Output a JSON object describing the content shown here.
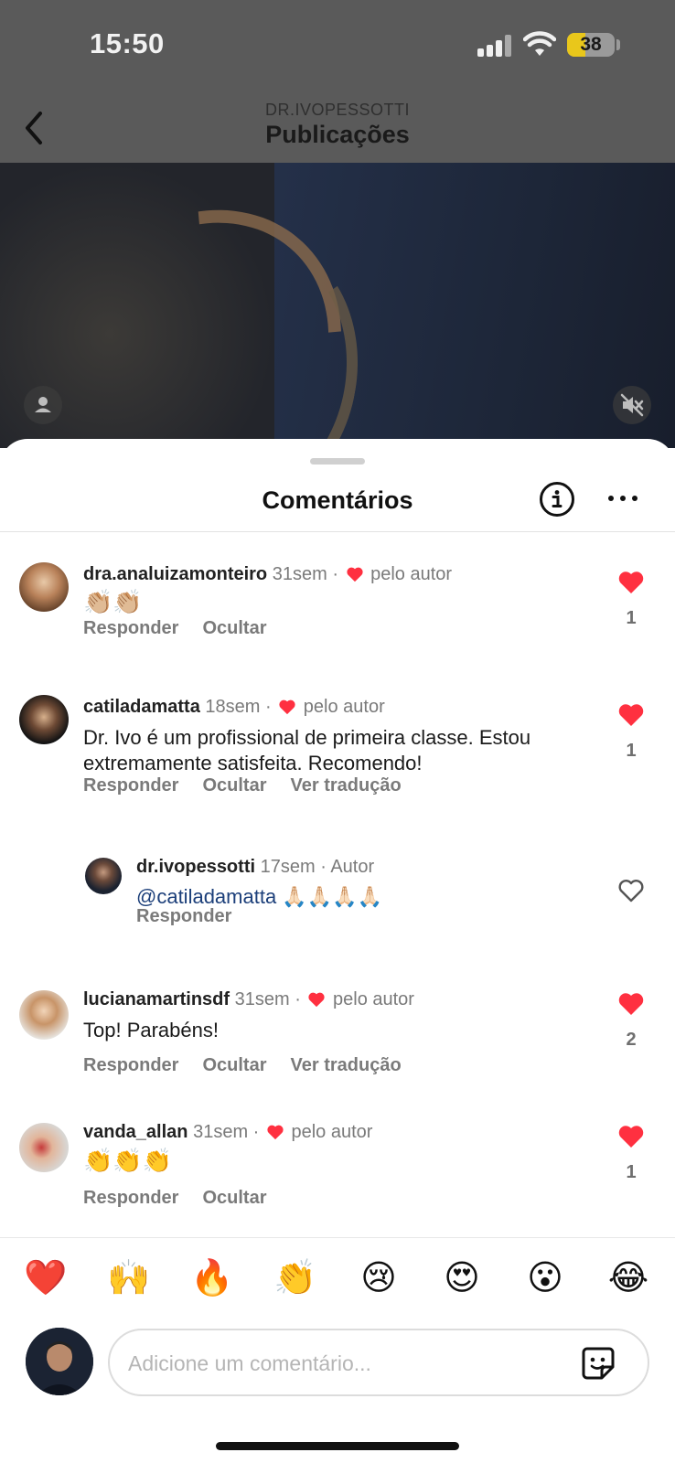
{
  "status_bar": {
    "time": "15:50",
    "battery": "38",
    "battery_level": 0.38
  },
  "header": {
    "subtitle": "DR.IVOPESSOTTI",
    "title": "Publicações"
  },
  "sheet": {
    "title": "Comentários"
  },
  "comments": [
    {
      "user": "dra.analuizamonteiro",
      "time": "31sem",
      "liked_by_author": "pelo autor",
      "text": "👏🏼👏🏼",
      "actions": [
        "Responder",
        "Ocultar"
      ],
      "likes": "1",
      "liked": true
    },
    {
      "user": "catiladamatta",
      "time": "18sem",
      "liked_by_author": "pelo autor",
      "text": "Dr. Ivo é um profissional de primeira classe. Estou extremamente satisfeita. Recomendo!",
      "actions": [
        "Responder",
        "Ocultar",
        "Ver tradução"
      ],
      "likes": "1",
      "liked": true
    },
    {
      "user": "dr.ivopessotti",
      "time": "17sem",
      "author_label": "Autor",
      "mention": "@catiladamatta",
      "text": "🙏🏻🙏🏻🙏🏻🙏🏻",
      "actions": [
        "Responder"
      ],
      "liked": false
    },
    {
      "user": "lucianamartinsdf",
      "time": "31sem",
      "liked_by_author": "pelo autor",
      "text": "Top! Parabéns!",
      "actions": [
        "Responder",
        "Ocultar",
        "Ver tradução"
      ],
      "likes": "2",
      "liked": true
    },
    {
      "user": "vanda_allan",
      "time": "31sem",
      "liked_by_author": "pelo autor",
      "text": "👏👏👏",
      "actions": [
        "Responder",
        "Ocultar"
      ],
      "likes": "1",
      "liked": true
    }
  ],
  "reactions": [
    "❤️",
    "🙌",
    "🔥",
    "👏",
    "😢",
    "😍",
    "😮",
    "😂"
  ],
  "composer": {
    "placeholder": "Adicione um comentário..."
  },
  "colors": {
    "like_red": "#ff3040",
    "mention_blue": "#1c3f7a",
    "meta_gray": "#7a7a7a"
  },
  "icons": {
    "back": "chevron-left-icon",
    "info": "info-icon",
    "more": "more-horizontal-icon",
    "like": "heart-icon",
    "sticker": "sticker-icon",
    "mute": "speaker-muted-icon",
    "user": "user-icon"
  }
}
